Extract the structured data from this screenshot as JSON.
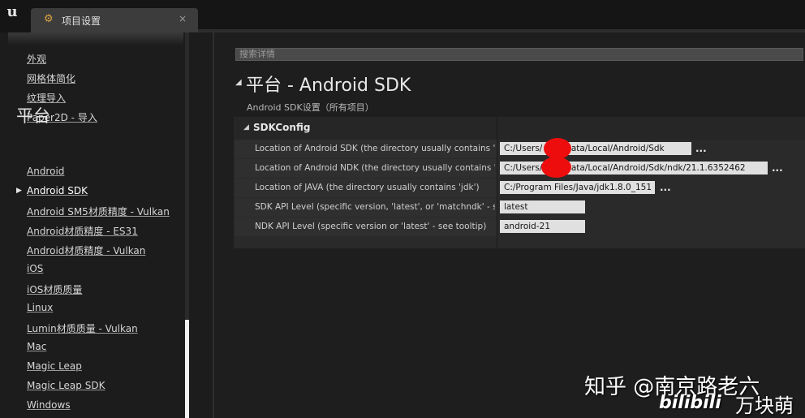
{
  "app": {
    "tab_title": "项目设置",
    "tab_close": "×",
    "logo_glyph": "u",
    "tab_icon_glyph": "⚙"
  },
  "sidebar": {
    "items_top": [
      "外观",
      "网格体简化",
      "纹理导入",
      "Paper2D - 导入"
    ],
    "heading": "平台",
    "items": [
      "Android",
      "Android SDK",
      "Android SM5材质精度 - Vulkan",
      "Android材质精度 - ES31",
      "Android材质精度 - Vulkan",
      "iOS",
      "iOS材质质量",
      "Linux",
      "Lumin材质质量 - Vulkan",
      "Mac",
      "Magic Leap",
      "Magic Leap SDK",
      "Windows"
    ],
    "selected_index": 1
  },
  "search": {
    "placeholder": "搜索详情"
  },
  "page": {
    "title": "平台 - Android SDK",
    "subtitle": "Android SDK设置（所有项目）"
  },
  "category": {
    "title": "SDKConfig",
    "properties": [
      {
        "name": "Location of Android SDK (the directory usually contains 'android-sdk-')",
        "value": "C:/Users/      /AppData/Local/Android/Sdk",
        "has_browse": true
      },
      {
        "name": "Location of Android NDK (the directory usually contains 'android-ndk-')",
        "value": "C:/Users/      /AppData/Local/Android/Sdk/ndk/21.1.6352462",
        "has_browse": true
      },
      {
        "name": "Location of JAVA (the directory usually contains 'jdk')",
        "value": "C:/Program Files/Java/jdk1.8.0_151",
        "has_browse": true
      },
      {
        "name": "SDK API Level (specific version, 'latest', or 'matchndk' - see tooltip)",
        "value": "latest",
        "has_browse": false
      },
      {
        "name": "NDK API Level (specific version or 'latest' - see tooltip)",
        "value": "android-21",
        "has_browse": false
      }
    ],
    "browse_label": "..."
  },
  "watermark": {
    "zhihu": "知乎 @南京路老六",
    "bili_logo": "bilibili",
    "bili_name": "万块萌"
  },
  "colors": {
    "background": "#1e1e1e",
    "panel": "#2a2a2a",
    "field": "#e0e0e0",
    "redaction": "#ee0d0d"
  }
}
